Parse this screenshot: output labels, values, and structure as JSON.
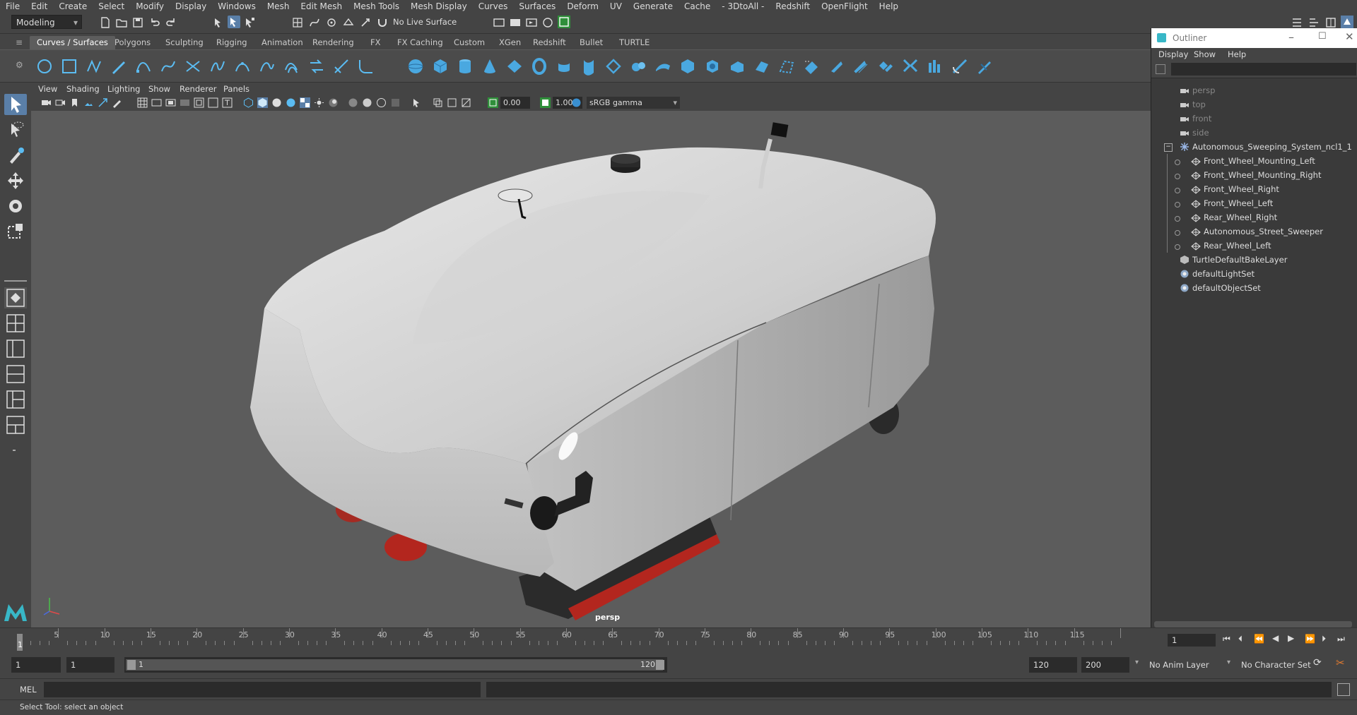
{
  "menubar": {
    "items": [
      "File",
      "Edit",
      "Create",
      "Select",
      "Modify",
      "Display",
      "Windows",
      "Mesh",
      "Edit Mesh",
      "Mesh Tools",
      "Mesh Display",
      "Curves",
      "Surfaces",
      "Deform",
      "UV",
      "Generate",
      "Cache",
      "- 3DtoAll -",
      "Redshift",
      "OpenFlight",
      "Help"
    ]
  },
  "status": {
    "mode": "Modeling",
    "live_surface": "No Live Surface"
  },
  "shelf": {
    "tabs": [
      "Curves / Surfaces",
      "Polygons",
      "Sculpting",
      "Rigging",
      "Animation",
      "Rendering",
      "FX",
      "FX Caching",
      "Custom",
      "XGen",
      "Redshift",
      "Bullet",
      "TURTLE"
    ],
    "active_tab": "Curves / Surfaces"
  },
  "panel": {
    "menu": [
      "View",
      "Shading",
      "Lighting",
      "Show",
      "Renderer",
      "Panels"
    ],
    "exposure": "0.00",
    "gamma": "1.00",
    "color_space": "sRGB gamma",
    "camera_label": "persp"
  },
  "outliner": {
    "title": "Outliner",
    "menu": [
      "Display",
      "Show",
      "Help"
    ],
    "rows": [
      {
        "label": "persp",
        "indent": 1,
        "type": "camera",
        "dim": true
      },
      {
        "label": "top",
        "indent": 1,
        "type": "camera",
        "dim": true
      },
      {
        "label": "front",
        "indent": 1,
        "type": "camera",
        "dim": true
      },
      {
        "label": "side",
        "indent": 1,
        "type": "camera",
        "dim": true
      },
      {
        "label": "Autonomous_Sweeping_System_ncl1_1",
        "indent": 1,
        "type": "group",
        "expanded": true
      },
      {
        "label": "Front_Wheel_Mounting_Left",
        "indent": 2,
        "type": "mesh"
      },
      {
        "label": "Front_Wheel_Mounting_Right",
        "indent": 2,
        "type": "mesh"
      },
      {
        "label": "Front_Wheel_Right",
        "indent": 2,
        "type": "mesh"
      },
      {
        "label": "Front_Wheel_Left",
        "indent": 2,
        "type": "mesh"
      },
      {
        "label": "Rear_Wheel_Right",
        "indent": 2,
        "type": "mesh"
      },
      {
        "label": "Autonomous_Street_Sweeper",
        "indent": 2,
        "type": "mesh"
      },
      {
        "label": "Rear_Wheel_Left",
        "indent": 2,
        "type": "mesh"
      },
      {
        "label": "TurtleDefaultBakeLayer",
        "indent": 1,
        "type": "layer"
      },
      {
        "label": "defaultLightSet",
        "indent": 1,
        "type": "set"
      },
      {
        "label": "defaultObjectSet",
        "indent": 1,
        "type": "set"
      }
    ]
  },
  "timeline": {
    "ticks": [
      "5",
      "10",
      "15",
      "20",
      "25",
      "30",
      "35",
      "40",
      "45",
      "50",
      "55",
      "60",
      "65",
      "70",
      "75",
      "80",
      "85",
      "90",
      "95",
      "100",
      "105",
      "110",
      "115"
    ],
    "current_frame_label": "1",
    "current_frame_field": "1"
  },
  "range": {
    "start": "1",
    "playback_start": "1",
    "slider_start": "1",
    "slider_end": "120",
    "playback_end": "120",
    "end": "200",
    "anim_layer": "No Anim Layer",
    "character_set": "No Character Set"
  },
  "cmdline": {
    "label": "MEL"
  },
  "helpline": {
    "text": "Select Tool: select an object"
  },
  "colors": {
    "accent": "#4ab3ff",
    "viewport_bg": "#5c5c5c",
    "model_body": "#d7d7d7",
    "brush_red": "#b3261e"
  }
}
